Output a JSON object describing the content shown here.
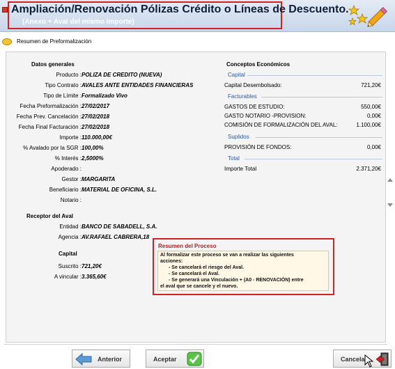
{
  "header": {
    "title": "Ampliación/Renovación Pólizas Crédito o Líneas de Descuento.",
    "subtitle": "(Anexo + Aval del mismo importe)"
  },
  "tab": {
    "label": "Resumen de Preformalización"
  },
  "datos_generales": {
    "title": "Datos generales",
    "rows": [
      {
        "label": "Producto :",
        "value": "POLIZA DE CREDITO (NUEVA)"
      },
      {
        "label": "Tipo Contrato :",
        "value": "AVALES ANTE ENTIDADES FINANCIERAS"
      },
      {
        "label": "Tipo de Límite :",
        "value": "Formalizado Vivo"
      },
      {
        "label": "Fecha Preformalización :",
        "value": "27/02/2017"
      },
      {
        "label": "Fecha Prev. Cancelación :",
        "value": "27/02/2018"
      },
      {
        "label": "Fecha Final Facturación :",
        "value": "27/02/2018"
      },
      {
        "label": "Importe :",
        "value": "110.000,00€"
      },
      {
        "label": "% Avalado por la SGR :",
        "value": "100,00%"
      },
      {
        "label": "% Interés :",
        "value": "2,5000%"
      },
      {
        "label": "Apoderado :",
        "value": ""
      },
      {
        "label": "Gestor :",
        "value": "MARGARITA"
      },
      {
        "label": "Beneficiario :",
        "value": "MATERIAL DE OFICINA, S.L."
      },
      {
        "label": "Notario :",
        "value": ""
      }
    ]
  },
  "receptor": {
    "title": "Receptor del Aval",
    "rows": [
      {
        "label": "Entidad :",
        "value": "BANCO DE SABADELL, S.A."
      },
      {
        "label": "Agencia :",
        "value": "AV.RAFAEL CABRERA,18"
      }
    ]
  },
  "capital": {
    "title": "Capital",
    "rows": [
      {
        "label": "Suscrito :",
        "value": "721,20€"
      },
      {
        "label": "A vincular :",
        "value": "3.365,60€"
      }
    ]
  },
  "conceptos": {
    "title": "Conceptos Económicos",
    "capital_group": "Capital",
    "capital_desembolsado_label": "Capital Desembolsado:",
    "capital_desembolsado_value": "721,20€",
    "facturables_group": "Facturables",
    "gastos_estudio_label": "GASTOS DE ESTUDIO:",
    "gastos_estudio_value": "550,00€",
    "gasto_notario_label": "GASTO NOTARIO -PROVISION:",
    "gasto_notario_value": "0,00€",
    "comision_label": "COMISIÓN DE FORMALIZACIÓN DEL AVAL:",
    "comision_value": "1.100,00€",
    "suplidos_group": "Suplidos",
    "provision_label": "PROVISIÓN DE FONDOS:",
    "provision_value": "0,00€",
    "total_group": "Total",
    "importe_total_label": "Importe Total",
    "importe_total_value": "2.371,20€"
  },
  "resumen": {
    "title": "Resumen del Proceso",
    "lines": [
      "Al formalizar este proceso se van a realizar las siguientes",
      "acciones:",
      "     - Se cancelará el riesgo del Aval.",
      "     - Se cancelará el Aval.",
      "     - Se generará una Vinculación + (A0 - RENOVACIÓN) entre",
      "el aval que se cancele y el nuevo."
    ]
  },
  "buttons": {
    "anterior": "Anterior",
    "aceptar": "Aceptar",
    "cancelar": "Cancela"
  }
}
